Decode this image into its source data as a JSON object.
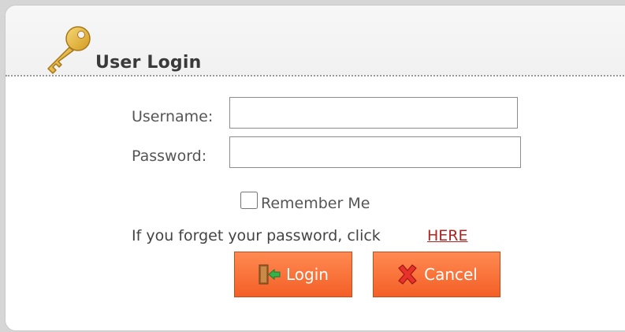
{
  "header": {
    "title": "User Login",
    "icon": "key-icon"
  },
  "form": {
    "username": {
      "label": "Username:",
      "value": "",
      "placeholder": ""
    },
    "password": {
      "label": "Password:",
      "value": "",
      "placeholder": ""
    },
    "remember": {
      "label": "Remember Me",
      "checked": false
    },
    "forgot": {
      "text": "If you forget your password, click",
      "link_label": "HERE"
    }
  },
  "buttons": {
    "login": {
      "label": "Login",
      "icon": "door-enter-icon"
    },
    "cancel": {
      "label": "Cancel",
      "icon": "red-x-icon"
    }
  },
  "colors": {
    "button_top": "#ff8a52",
    "button_bottom": "#f35f26",
    "link": "#b0251f",
    "key": "#e5b53a"
  }
}
